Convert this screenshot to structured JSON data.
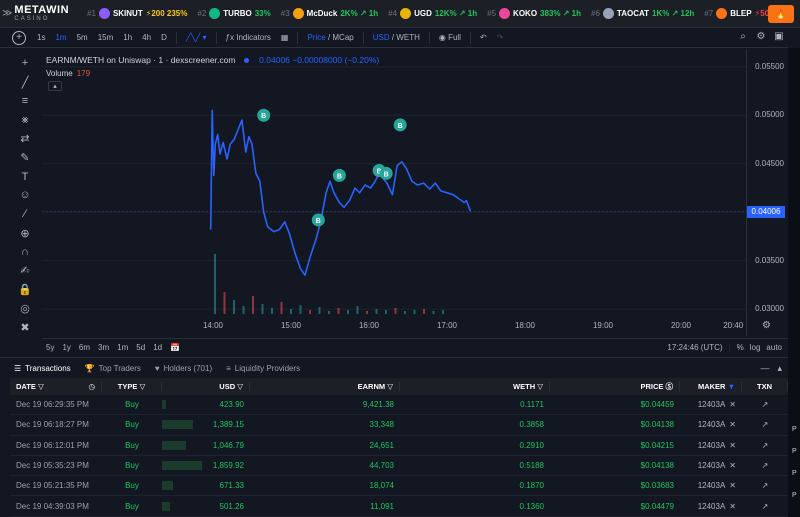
{
  "ticker": {
    "brand_top": "METAWIN",
    "brand_bottom": "CASINO",
    "items": [
      {
        "rank": "#1",
        "symbol": "SKINUT",
        "change": "⚡200 235%",
        "tone": "hot",
        "color": "#8b5cf6"
      },
      {
        "rank": "#2",
        "symbol": "TURBO",
        "change": "33%",
        "tone": "up",
        "color": "#10b981"
      },
      {
        "rank": "#3",
        "symbol": "McDuck",
        "change": "2K% ↗ 1h",
        "tone": "up",
        "color": "#f59e0b"
      },
      {
        "rank": "#4",
        "symbol": "UGD",
        "change": "12K% ↗ 1h",
        "tone": "up",
        "color": "#eab308"
      },
      {
        "rank": "#5",
        "symbol": "KOKO",
        "change": "383% ↗ 1h",
        "tone": "up",
        "color": "#ec4899"
      },
      {
        "rank": "#6",
        "symbol": "TAOCAT",
        "change": "1K% ↗ 12h",
        "tone": "up",
        "color": "#94a3b8"
      },
      {
        "rank": "#7",
        "symbol": "BLEP",
        "change": "⚡50 -13%",
        "tone": "dn",
        "color": "#f97316"
      }
    ]
  },
  "toolbar": {
    "intervals": [
      "1s",
      "1m",
      "5m",
      "15m",
      "1h",
      "4h",
      "D"
    ],
    "active_interval": "1m",
    "indicators": "Indicators",
    "price": "Price",
    "mcap": "/ MCap",
    "usd": "USD",
    "weth": "/ WETH",
    "full": "Full"
  },
  "chart_header": {
    "pair": "EARNM/WETH on Uniswap · 1 · dexscreener.com",
    "values": "0.04006  −0.00008000 (−0.20%)",
    "volume_label": "Volume",
    "volume_value": "179"
  },
  "chart_data": {
    "type": "line",
    "x_ticks": [
      "14:00",
      "15:00",
      "16:00",
      "17:00",
      "18:00",
      "19:00",
      "20:00",
      "20:40"
    ],
    "y_ticks": [
      "0.05500",
      "0.05000",
      "0.04500",
      "0.04000",
      "0.03500",
      "0.03000"
    ],
    "ylim": [
      0.0295,
      0.0558
    ],
    "last_price": "0.04006",
    "markers": [
      "B",
      "B",
      "B",
      "B",
      "B",
      "B"
    ]
  },
  "rangebar": {
    "ranges": [
      "5y",
      "1y",
      "6m",
      "3m",
      "1m",
      "5d",
      "1d"
    ],
    "time": "17:24:46 (UTC)",
    "pct": "%",
    "log": "log",
    "auto": "auto"
  },
  "tabs": {
    "transactions": "Transactions",
    "top_traders": "Top Traders",
    "holders": "Holders (701)",
    "liquidity": "Liquidity Providers"
  },
  "table": {
    "headers": {
      "date": "DATE",
      "type": "TYPE",
      "usd": "USD",
      "earnm": "EARNM",
      "weth": "WETH",
      "price": "PRICE",
      "maker": "MAKER",
      "txn": "TXN"
    },
    "rows": [
      {
        "date": "Dec 19 06:29:35 PM",
        "type": "Buy",
        "usd": "423.90",
        "earnm": "9,421.38",
        "weth": "0.1171",
        "price": "$0.04459",
        "maker": "12403A",
        "bar": 0.05
      },
      {
        "date": "Dec 19 06:18:27 PM",
        "type": "Buy",
        "usd": "1,389.15",
        "earnm": "33,348",
        "weth": "0.3858",
        "price": "$0.04138",
        "maker": "12403A",
        "bar": 0.35
      },
      {
        "date": "Dec 19 06:12:01 PM",
        "type": "Buy",
        "usd": "1,046.79",
        "earnm": "24,651",
        "weth": "0.2910",
        "price": "$0.04215",
        "maker": "12403A",
        "bar": 0.27
      },
      {
        "date": "Dec 19 05:35:23 PM",
        "type": "Buy",
        "usd": "1,859.92",
        "earnm": "44,703",
        "weth": "0.5188",
        "price": "$0.04138",
        "maker": "12403A",
        "bar": 0.45
      },
      {
        "date": "Dec 19 05:21:35 PM",
        "type": "Buy",
        "usd": "671.33",
        "earnm": "18,074",
        "weth": "0.1870",
        "price": "$0.03683",
        "maker": "12403A",
        "bar": 0.13
      },
      {
        "date": "Dec 19 04:39:03 PM",
        "type": "Buy",
        "usd": "501.26",
        "earnm": "11,091",
        "weth": "0.1360",
        "price": "$0.04479",
        "maker": "12403A",
        "bar": 0.09
      }
    ]
  },
  "colors": {
    "line": "#2962ff",
    "buy": "#22c55e",
    "marker": "#26a69a",
    "bg": "#131722"
  }
}
